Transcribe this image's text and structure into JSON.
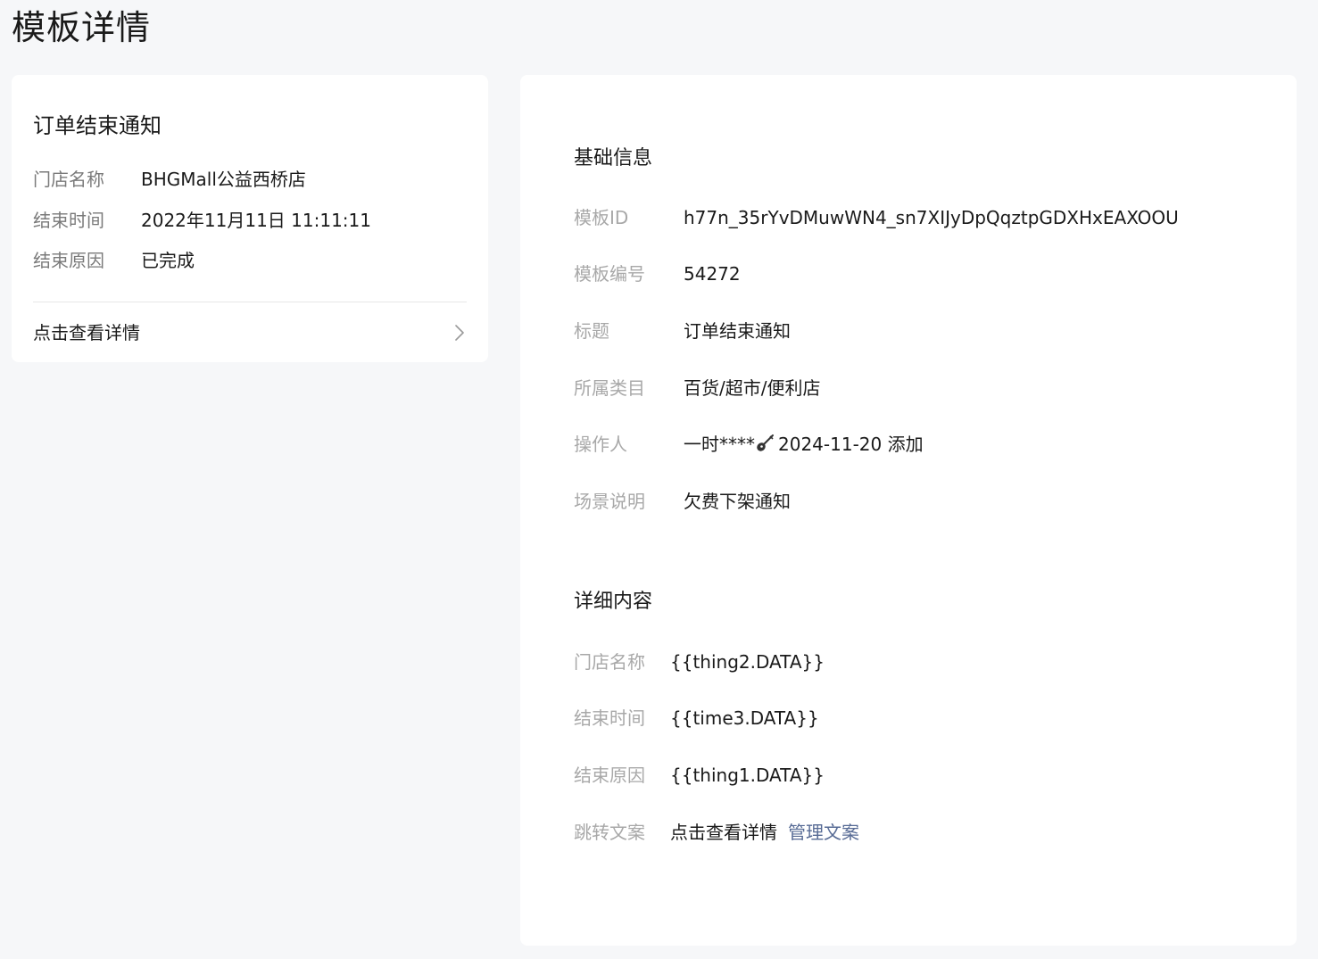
{
  "page": {
    "title": "模板详情"
  },
  "preview": {
    "title": "订单结束通知",
    "fields": [
      {
        "label": "门店名称",
        "value": "BHGMall公益西桥店"
      },
      {
        "label": "结束时间",
        "value": "2022年11月11日 11:11:11"
      },
      {
        "label": "结束原因",
        "value": "已完成"
      }
    ],
    "link_label": "点击查看详情"
  },
  "basic_info": {
    "section_title": "基础信息",
    "template_id_label": "模板ID",
    "template_id": "h77n_35rYvDMuwWN4_sn7XIJyDpQqztpGDXHxEAXOOU",
    "template_no_label": "模板编号",
    "template_no": "54272",
    "title_label": "标题",
    "title": "订单结束通知",
    "category_label": "所属类目",
    "category": "百货/超市/便利店",
    "operator_label": "操作人",
    "operator_name": "一时****",
    "operator_icon": "guitar-icon",
    "operator_action": "2024-11-20 添加",
    "scene_label": "场景说明",
    "scene": "欠费下架通知"
  },
  "detail_content": {
    "section_title": "详细内容",
    "fields": [
      {
        "label": "门店名称",
        "value": "{{thing2.DATA}}"
      },
      {
        "label": "结束时间",
        "value": "{{time3.DATA}}"
      },
      {
        "label": "结束原因",
        "value": "{{thing1.DATA}}"
      }
    ],
    "jump_label": "跳转文案",
    "jump_value": "点击查看详情",
    "manage_link": "管理文案"
  },
  "colors": {
    "background": "#f6f7f9",
    "card": "#ffffff",
    "label_gray": "#a8a8a8",
    "link_blue": "#576b95"
  }
}
